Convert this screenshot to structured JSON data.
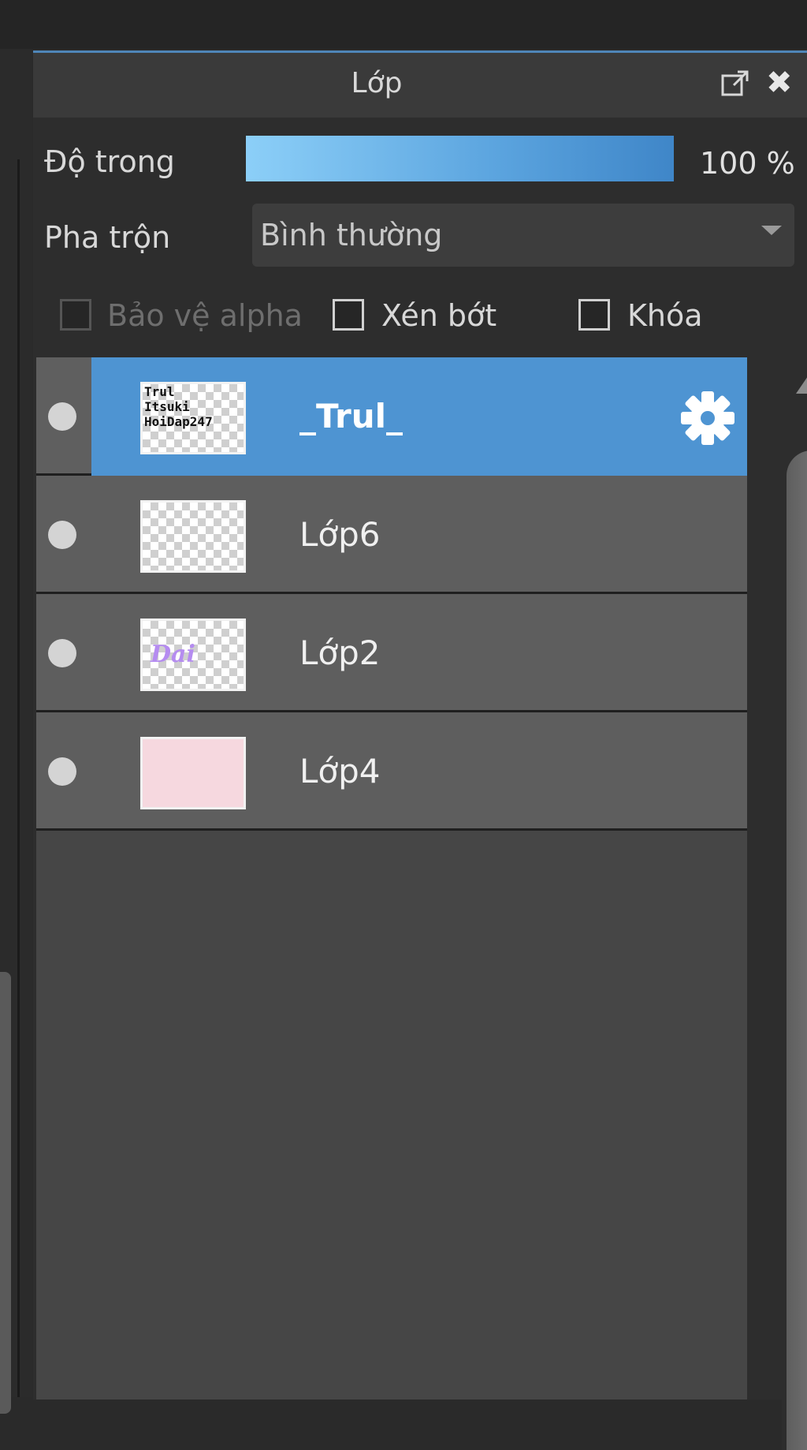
{
  "panel": {
    "title": "Lớp"
  },
  "opacity": {
    "label": "Độ trong",
    "value_text": "100 %",
    "fraction": 1.0
  },
  "blend": {
    "label": "Pha trộn",
    "value": "Bình thường"
  },
  "checkboxes": [
    {
      "label": "Bảo vệ alpha",
      "checked": false,
      "disabled": true
    },
    {
      "label": "Xén bớt",
      "checked": false,
      "disabled": false
    },
    {
      "label": "Khóa",
      "checked": false,
      "disabled": false
    }
  ],
  "layers": [
    {
      "name": "_Trul_",
      "selected": true,
      "thumb": "text",
      "thumb_text": "Trul\nItsuki\nHoiDap247"
    },
    {
      "name": "Lớp6",
      "selected": false,
      "thumb": "transparent"
    },
    {
      "name": "Lớp2",
      "selected": false,
      "thumb": "text-purple",
      "thumb_text": "Dai"
    },
    {
      "name": "Lớp4",
      "selected": false,
      "thumb": "pink"
    }
  ],
  "colors": {
    "accent": "#4e94d2",
    "panel_bg": "#2d2d2d",
    "row_bg": "#5e5e5e"
  },
  "icons": {
    "popout": "popout-icon",
    "close": "close-icon",
    "settings": "gear-icon",
    "visibility": "visibility-dot-icon"
  }
}
